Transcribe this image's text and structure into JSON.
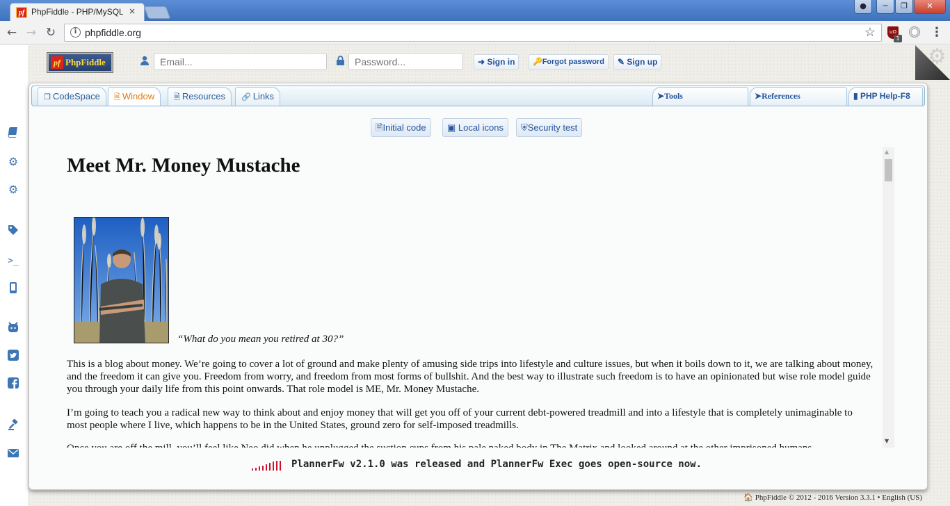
{
  "browser": {
    "tab_title": "PhpFiddle - PHP/MySQL",
    "tab_close": "×",
    "url": "phpfiddle.org",
    "ublock_badge": "1"
  },
  "header": {
    "logo_text": "PhpFiddle",
    "logo_mark": "pf",
    "email_placeholder": "Email...",
    "password_placeholder": "Password...",
    "signin_label": "Sign in",
    "forgot_label": "Forgot password",
    "signup_label": "Sign up"
  },
  "tabs": {
    "left": [
      {
        "label": "CodeSpace",
        "icon": "copy-icon"
      },
      {
        "label": "Window",
        "icon": "file-icon"
      },
      {
        "label": "Resources",
        "icon": "file-text-icon"
      },
      {
        "label": "Links",
        "icon": "link-icon"
      }
    ],
    "right": [
      {
        "label": "Tools",
        "icon": "location-arrow-icon"
      },
      {
        "label": "References",
        "icon": "location-arrow-icon"
      },
      {
        "label": "PHP Help-F8",
        "icon": "book-icon"
      }
    ]
  },
  "content_buttons": [
    {
      "label": "Initial code",
      "icon": "file-code-icon"
    },
    {
      "label": "Local icons",
      "icon": "image-icon"
    },
    {
      "label": "Security test",
      "icon": "shield-icon"
    }
  ],
  "sidebar_icons": [
    "book-icon",
    "cogs-icon",
    "gear-icon",
    "tag-icon",
    "terminal-icon",
    "mobile-icon",
    "github-icon",
    "twitter-icon",
    "facebook-icon",
    "gavel-icon",
    "envelope-icon"
  ],
  "article": {
    "title": "Meet Mr. Money Mustache",
    "caption": "“What do you mean you retired at 30?”",
    "paragraph1": "This is a blog about money. We’re going to cover a lot of ground and make plenty of amusing side trips into lifestyle and culture issues, but when it boils down to it, we are talking about money, and the freedom it can give you. Freedom from worry, and freedom from most forms of bullshit. And the best way to illustrate such freedom is to have an opinionated but wise role model guide you through your daily life from this point onwards. That role model is ME, Mr. Money Mustache.",
    "paragraph2": "I’m going to teach you a radical new way to think about and enjoy money that will get you off of your current debt-powered treadmill and into a lifestyle that is completely unimaginable to most people where I live, which happens to be in the United States, ground zero for self-imposed treadmills.",
    "paragraph3": "Once you are off the mill, you’ll feel like Neo did when he unplugged the suction cups from his pale naked body in The Matrix and looked around at the other imprisoned humans"
  },
  "announcement": "PlannerFw v2.1.0 was released and PlannerFw Exec goes open-source now.",
  "footer": "🏠 PhpFiddle © 2012 - 2016 Version 3.3.1 • English (US)",
  "colors": {
    "accent": "#24549a",
    "active_tab": "#e07a12",
    "signal": "#d0102a"
  }
}
